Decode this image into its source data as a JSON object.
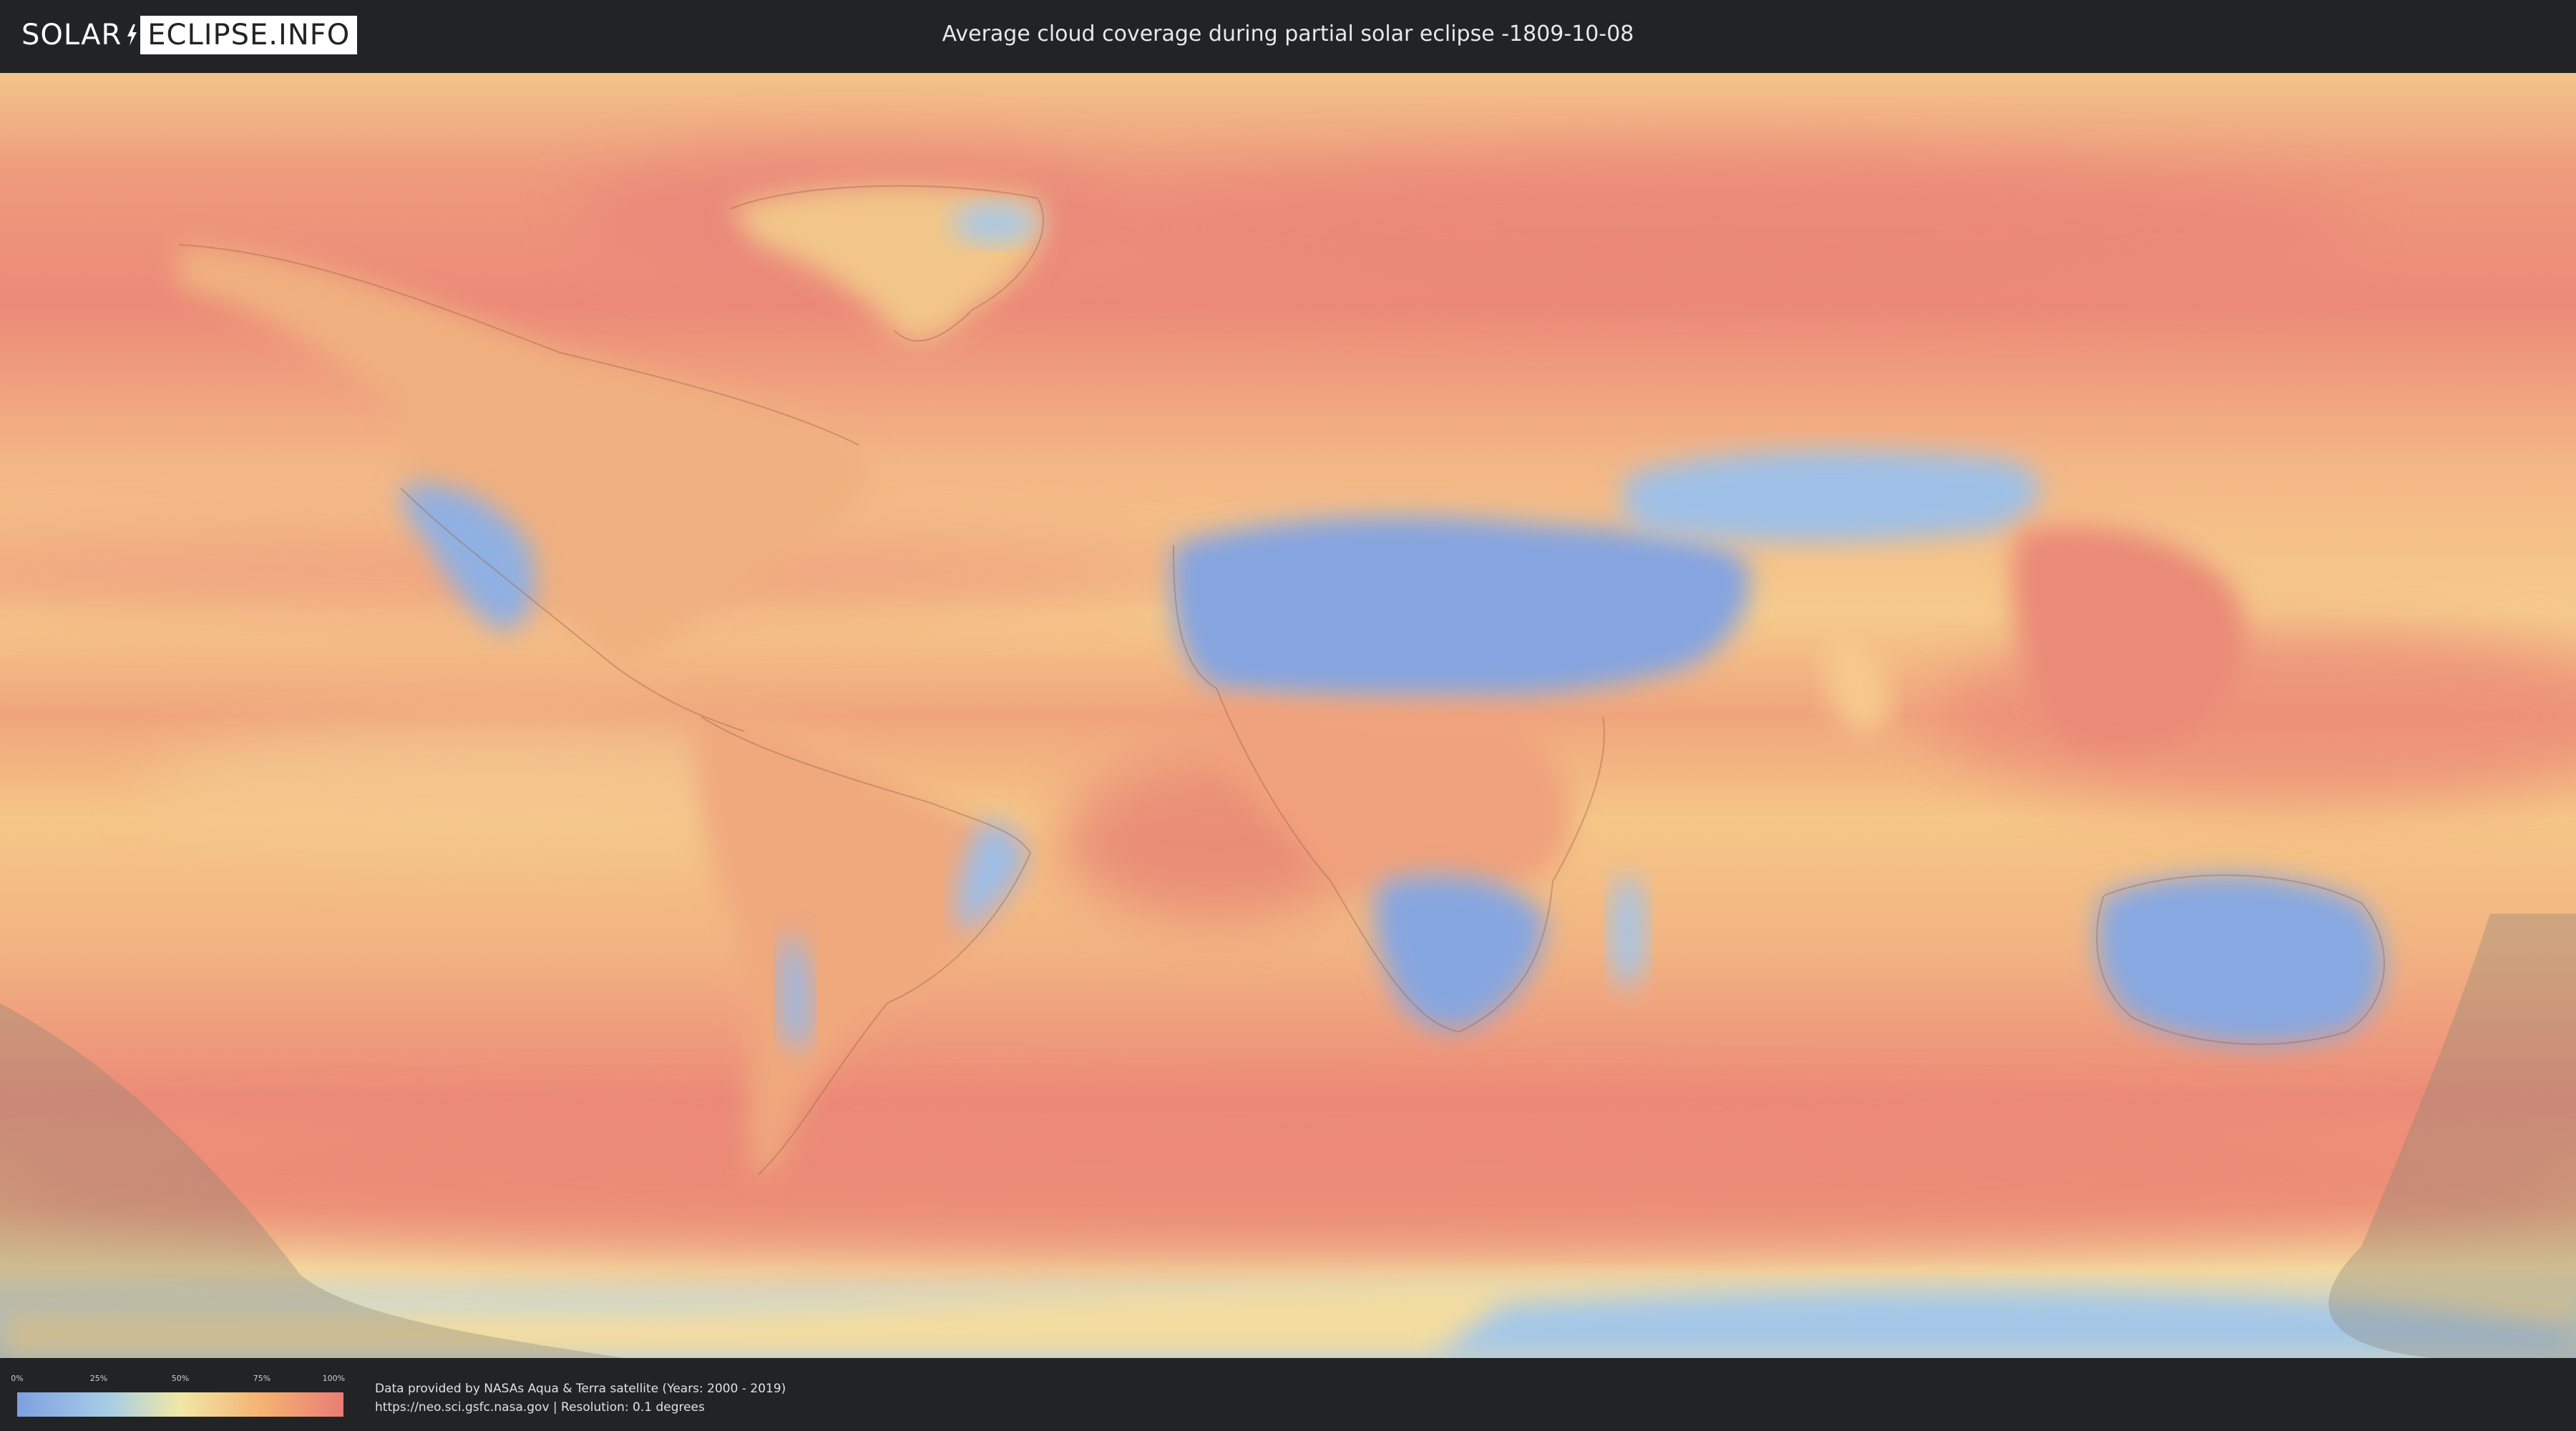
{
  "header": {
    "logo_left": "SOLAR",
    "logo_right": "ECLIPSE.INFO",
    "title": "Average cloud coverage during partial solar eclipse -1809-10-08"
  },
  "legend": {
    "ticks": [
      "0%",
      "25%",
      "50%",
      "75%",
      "100%"
    ],
    "gradient_colors": [
      "#7ea0e0",
      "#a7cde6",
      "#f1e7a6",
      "#f5b272",
      "#ea7c74"
    ]
  },
  "credits": {
    "line1": "Data provided by NASAs Aqua & Terra satellite (Years: 2000 - 2019)",
    "line2": "https://neo.sci.gsfc.nasa.gov | Resolution: 0.1 degrees"
  },
  "colors": {
    "background": "#222324",
    "ocean_cloudy": "#ec8a78",
    "ocean_moderate": "#f5c487",
    "clear_sky": "#7ea0e0",
    "eclipse_shade": "#8a8575"
  }
}
